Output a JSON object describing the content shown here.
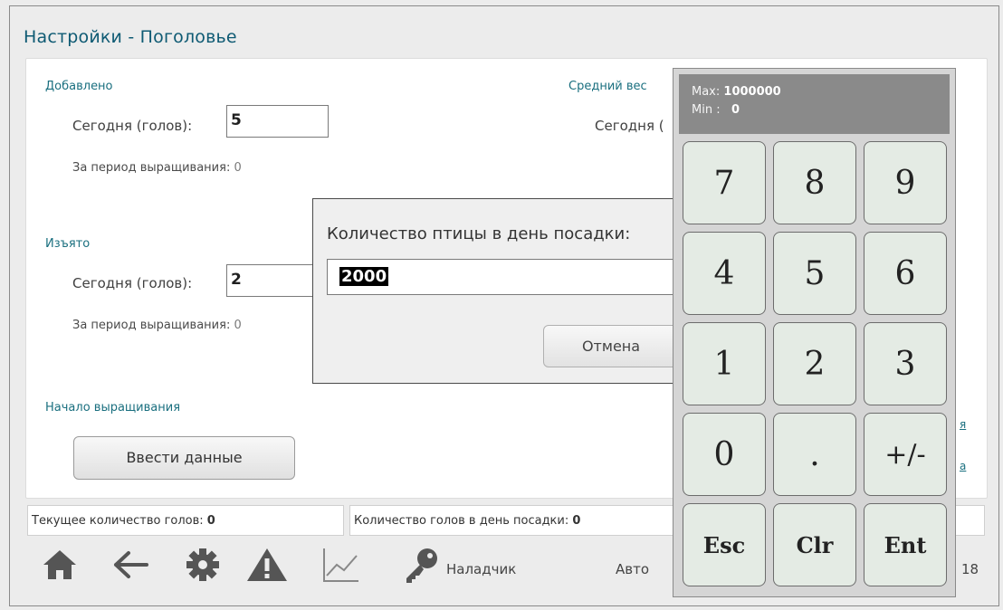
{
  "title": "Настройки - Поголовье",
  "added": {
    "section_label": "Добавлено",
    "today_label": "Сегодня (голов):",
    "today_value": "5",
    "period_label": "За период выращивания:",
    "period_value": "0"
  },
  "removed": {
    "section_label": "Изъято",
    "today_label": "Сегодня (голов):",
    "today_value": "2",
    "period_label": "За период выращивания:",
    "period_value": "0"
  },
  "avg_weight": {
    "section_label": "Средний вес",
    "today_label": "Сегодня ("
  },
  "start": {
    "section_label": "Начало выращивания",
    "enter_button": "Ввести данные"
  },
  "right_links": [
    "я",
    "а"
  ],
  "status": {
    "current_label": "Текущее количество голов:",
    "current_value": "0",
    "placement_label": "Количество голов в день посадки:",
    "placement_value": "0"
  },
  "toolbar": {
    "user_label": "Наладчик",
    "mode_label": "Авто",
    "date_fragment": "18"
  },
  "dialog": {
    "prompt": "Количество птицы в день посадки:",
    "value": "2000",
    "cancel_label": "Отмена"
  },
  "keypad": {
    "max_label": "Max:",
    "max_value": "1000000",
    "min_label": "Min :",
    "min_value": "0",
    "keys": [
      "7",
      "8",
      "9",
      "4",
      "5",
      "6",
      "1",
      "2",
      "3",
      "0",
      ".",
      "+/-",
      "Esc",
      "Clr",
      "Ent"
    ]
  },
  "colors": {
    "accent": "#0e5a73",
    "keypad_key": "#e4ebe4",
    "keypad_display": "#8a8a8a"
  }
}
